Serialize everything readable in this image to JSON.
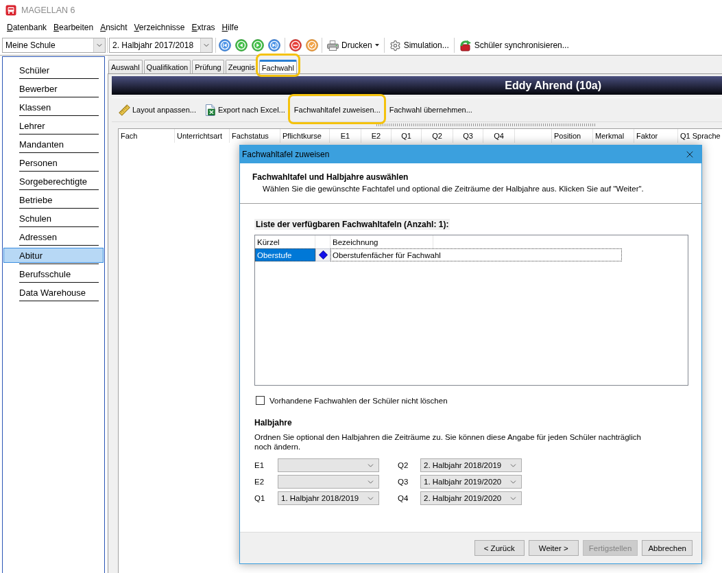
{
  "window": {
    "title": "MAGELLAN 6"
  },
  "menu": [
    "Datenbank",
    "Bearbeiten",
    "Ansicht",
    "Verzeichnisse",
    "Extras",
    "Hilfe"
  ],
  "toolbar": {
    "school": "Meine Schule",
    "period": "2. Halbjahr 2017/2018",
    "actions": [
      {
        "label": "Drucken",
        "menu": true
      },
      {
        "label": "Simulation...",
        "menu": false
      },
      {
        "label": "Schüler synchronisieren...",
        "menu": false
      }
    ]
  },
  "sidebar": {
    "items": [
      {
        "label": "Schüler",
        "selected": false
      },
      {
        "label": "Bewerber",
        "selected": false
      },
      {
        "label": "Klassen",
        "selected": false
      },
      {
        "label": "Lehrer",
        "selected": false
      },
      {
        "label": "Mandanten",
        "selected": false
      },
      {
        "label": "Personen",
        "selected": false
      },
      {
        "label": "Sorgeberechtigte",
        "selected": false
      },
      {
        "label": "Betriebe",
        "selected": false
      },
      {
        "label": "Schulen",
        "selected": false
      },
      {
        "label": "Adressen",
        "selected": false
      },
      {
        "label": "Abitur",
        "selected": true
      },
      {
        "label": "Berufsschule",
        "selected": false
      },
      {
        "label": "Data Warehouse",
        "selected": false
      }
    ]
  },
  "tabs": [
    {
      "label": "Auswahl",
      "selected": false,
      "highlighted": false
    },
    {
      "label": "Qualifikation",
      "selected": false,
      "highlighted": false
    },
    {
      "label": "Prüfung",
      "selected": false,
      "highlighted": false
    },
    {
      "label": "Zeugnis",
      "selected": false,
      "highlighted": false
    },
    {
      "label": "Fachwahl",
      "selected": true,
      "highlighted": true
    }
  ],
  "student": "Eddy Ahrend (10a)",
  "actions": [
    {
      "label": "Layout anpassen...",
      "highlighted": false
    },
    {
      "label": "Export nach Excel...",
      "highlighted": false
    },
    {
      "label": "Fachwahltafel zuweisen...",
      "highlighted": true
    },
    {
      "label": "Fachwahl übernehmen...",
      "highlighted": false
    }
  ],
  "grid": {
    "columns": [
      {
        "label": "Fach",
        "kind": "text"
      },
      {
        "label": "Unterrichtsart",
        "kind": "text"
      },
      {
        "label": "Fachstatus",
        "kind": "text"
      },
      {
        "label": "Pflichtkurse",
        "kind": "text"
      },
      {
        "label": "E1",
        "kind": "period"
      },
      {
        "label": "E2",
        "kind": "period"
      },
      {
        "label": "Q1",
        "kind": "period"
      },
      {
        "label": "Q2",
        "kind": "period"
      },
      {
        "label": "Q3",
        "kind": "period"
      },
      {
        "label": "Q4",
        "kind": "period"
      },
      {
        "kind": "blank"
      },
      {
        "label": "Position",
        "kind": "text"
      },
      {
        "label": "Merkmal",
        "kind": "text"
      },
      {
        "label": "Faktor",
        "kind": "text"
      },
      {
        "label": "Q1 Sprache",
        "kind": "text"
      }
    ]
  },
  "dialog": {
    "title": "Fachwahltafel zuweisen",
    "heading": "Fachwahltafel und Halbjahre auswählen",
    "description": "Wählen Sie die gewünschte Fachtafel und optional die Zeiträume der Halbjahre aus. Klicken Sie auf \"Weiter\".",
    "list_title": "Liste der verfügbaren Fachwahltafeln (Anzahl: 1):",
    "list": {
      "columns": [
        "Kürzel",
        "Bezeichnung"
      ],
      "rows": [
        {
          "kuerzel": "Oberstufe",
          "bezeichnung": "Oberstufenfächer für Fachwahl",
          "selected": true
        }
      ]
    },
    "keep_existing": {
      "label": "Vorhandene Fachwahlen der Schüler nicht löschen",
      "checked": false
    },
    "halbjahre": {
      "title": "Halbjahre",
      "text": "Ordnen Sie optional den Halbjahren die Zeiträume zu. Sie können diese Angabe für jeden Schüler nachträglich noch ändern.",
      "fields": [
        {
          "label": "E1"
        },
        {
          "label": "E2"
        },
        {
          "label": "Q1",
          "value": "1. Halbjahr 2018/2019"
        },
        {
          "label": "Q2",
          "value": "2. Halbjahr 2018/2019"
        },
        {
          "label": "Q3",
          "value": "1. Halbjahr 2019/2020"
        },
        {
          "label": "Q4",
          "value": "2. Halbjahr 2019/2020"
        }
      ]
    },
    "buttons": [
      {
        "label": "< Zurück",
        "disabled": false
      },
      {
        "label": "Weiter >",
        "disabled": false
      },
      {
        "label": "Fertigstellen",
        "disabled": true
      },
      {
        "label": "Abbrechen",
        "disabled": false
      }
    ]
  }
}
